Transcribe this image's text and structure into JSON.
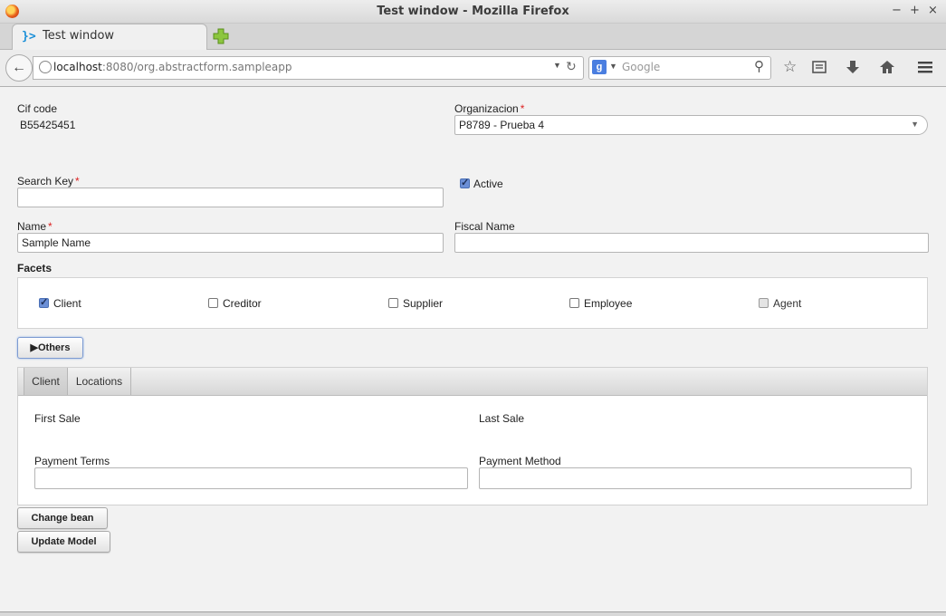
{
  "window": {
    "title": "Test window - Mozilla Firefox",
    "controls": {
      "minimize": "−",
      "maximize": "+",
      "close": "×"
    }
  },
  "browser": {
    "tab_title": "Test window",
    "tab_icon": "}>",
    "url_host": "localhost",
    "url_rest": ":8080/org.abstractform.sampleapp",
    "search_placeholder": "Google",
    "search_engine_letter": "g"
  },
  "form": {
    "cif_label": "Cif code",
    "cif_value": "B55425451",
    "org_label": "Organizacion",
    "org_value": "P8789 - Prueba 4",
    "search_key_label": "Search Key",
    "search_key_value": "",
    "active_label": "Active",
    "active_checked": true,
    "name_label": "Name",
    "name_value": "Sample Name",
    "fiscal_name_label": "Fiscal Name",
    "fiscal_name_value": "",
    "required_mark": "*"
  },
  "facets": {
    "title": "Facets",
    "items": [
      {
        "label": "Client",
        "checked": true
      },
      {
        "label": "Creditor",
        "checked": false
      },
      {
        "label": "Supplier",
        "checked": false
      },
      {
        "label": "Employee",
        "checked": false
      },
      {
        "label": "Agent",
        "checked": false,
        "disabled": true
      }
    ]
  },
  "others_button": "▶Others",
  "tabs": {
    "items": [
      {
        "label": "Client"
      },
      {
        "label": "Locations"
      }
    ],
    "active": "Client"
  },
  "client_tab": {
    "first_sale_label": "First Sale",
    "last_sale_label": "Last Sale",
    "payment_terms_label": "Payment Terms",
    "payment_terms_value": "",
    "payment_method_label": "Payment Method",
    "payment_method_value": ""
  },
  "buttons": {
    "change_bean": "Change bean",
    "update_model": "Update Model"
  }
}
